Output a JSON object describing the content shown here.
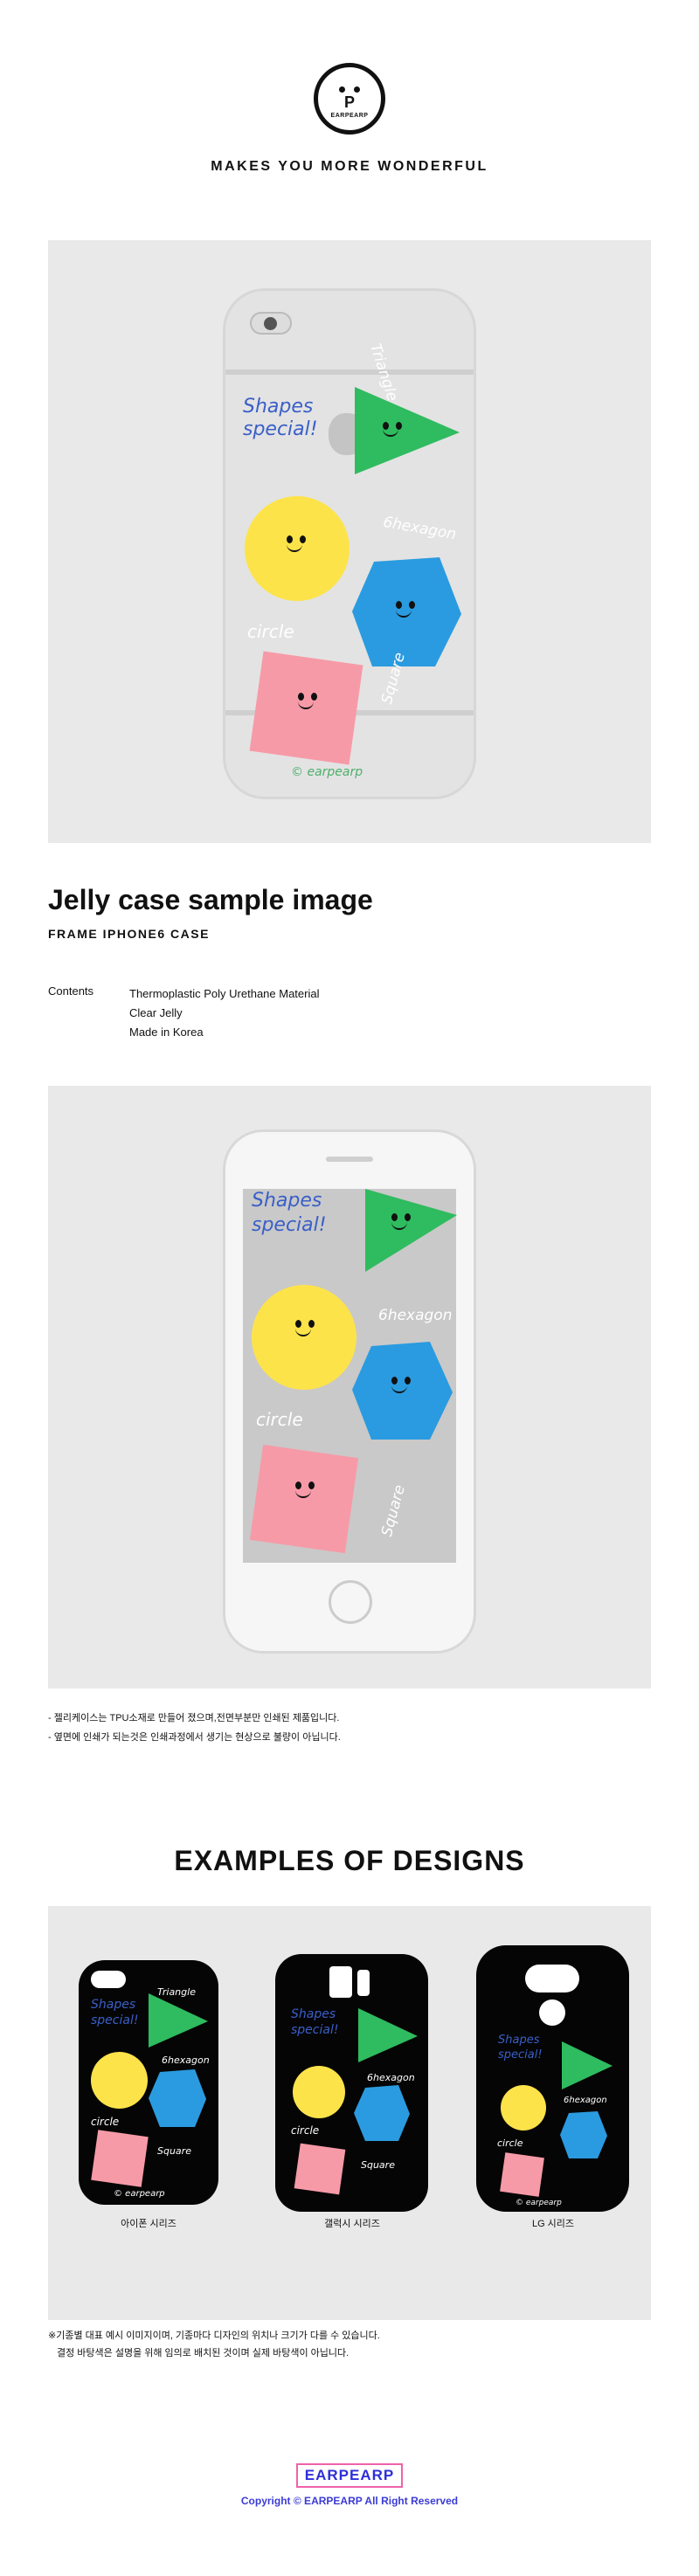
{
  "logo": {
    "letter": "P",
    "brand": "EARPEARP"
  },
  "tagline": "MAKES YOU MORE WONDERFUL",
  "art": {
    "shapes_special_1": "Shapes",
    "shapes_special_2": "special!",
    "triangle": "Triangle",
    "hexagon": "6hexagon",
    "circle": "circle",
    "square": "Square",
    "brand_mark": "© earpearp"
  },
  "section": {
    "title": "Jelly case sample image",
    "subtitle": "FRAME IPHONE6 CASE",
    "contents_label": "Contents",
    "contents": [
      "Thermoplastic Poly Urethane Material",
      "Clear Jelly",
      "Made in Korea"
    ]
  },
  "notes": [
    "- 젤리케이스는 TPU소재로 만들어 졌으며,전면부분만 인쇄된 제품입니다.",
    "- 옆면에 인쇄가 되는것은 인쇄과정에서 생기는 현상으로 불량이 아닙니다."
  ],
  "examples": {
    "title": "EXAMPLES OF DESIGNS",
    "labels": [
      "아이폰 시리즈",
      "갤럭시 시리즈",
      "LG 시리즈"
    ]
  },
  "footnote": [
    "※기종별 대표 예시 이미지이며, 기종마다 디자인의 위치나 크기가 다를 수 있습니다.",
    "결정 바탕색은 설명을 위해 임의로 배치된 것이며 실제 바탕색이 아닙니다."
  ],
  "footer": {
    "logo": "EARPEARP",
    "copyright": "Copyright © EARPEARP All Right Reserved"
  },
  "colors": {
    "yellow": "#fde34a",
    "green": "#2fbb5f",
    "blue": "#2a9be0",
    "pink": "#f79aa8",
    "panel": "#e9e9e9",
    "footer_blue": "#3b3bd6",
    "footer_pink": "#ef62a9"
  }
}
